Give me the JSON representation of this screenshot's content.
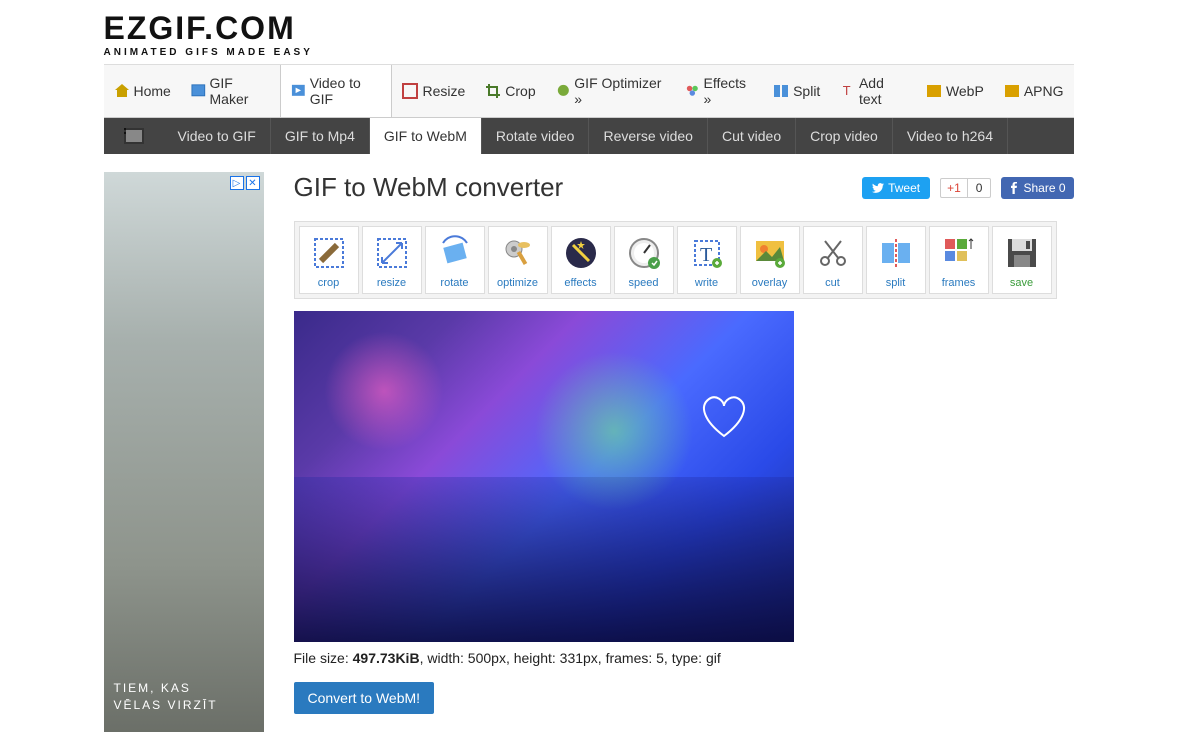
{
  "logo": {
    "main": "EZGIF.COM",
    "sub": "ANIMATED GIFS MADE EASY"
  },
  "nav1": [
    {
      "label": "Home"
    },
    {
      "label": "GIF Maker"
    },
    {
      "label": "Video to GIF",
      "active": true
    },
    {
      "label": "Resize"
    },
    {
      "label": "Crop"
    },
    {
      "label": "GIF Optimizer »"
    },
    {
      "label": "Effects »"
    },
    {
      "label": "Split"
    },
    {
      "label": "Add text"
    },
    {
      "label": "WebP"
    },
    {
      "label": "APNG"
    }
  ],
  "nav2": [
    {
      "label": "Video to GIF"
    },
    {
      "label": "GIF to Mp4"
    },
    {
      "label": "GIF to WebM",
      "active": true
    },
    {
      "label": "Rotate video"
    },
    {
      "label": "Reverse video"
    },
    {
      "label": "Cut video"
    },
    {
      "label": "Crop video"
    },
    {
      "label": "Video to h264"
    }
  ],
  "title": "GIF to WebM converter",
  "social": {
    "tweet": "Tweet",
    "gplus": "+1",
    "gplus_count": "0",
    "fb": "Share 0"
  },
  "tools": [
    {
      "key": "crop",
      "label": "crop"
    },
    {
      "key": "resize",
      "label": "resize"
    },
    {
      "key": "rotate",
      "label": "rotate"
    },
    {
      "key": "optimize",
      "label": "optimize"
    },
    {
      "key": "effects",
      "label": "effects"
    },
    {
      "key": "speed",
      "label": "speed"
    },
    {
      "key": "write",
      "label": "write"
    },
    {
      "key": "overlay",
      "label": "overlay"
    },
    {
      "key": "cut",
      "label": "cut"
    },
    {
      "key": "split",
      "label": "split"
    },
    {
      "key": "frames",
      "label": "frames"
    },
    {
      "key": "save",
      "label": "save"
    }
  ],
  "fileinfo": {
    "size_label": "File size: ",
    "size": "497.73KiB",
    "rest": ", width: 500px, height: 331px, frames: 5, type: gif"
  },
  "convert_label": "Convert to WebM!",
  "ad": {
    "text1": "TIEM, KAS",
    "text2": "VĒLAS VIRZĪT"
  }
}
